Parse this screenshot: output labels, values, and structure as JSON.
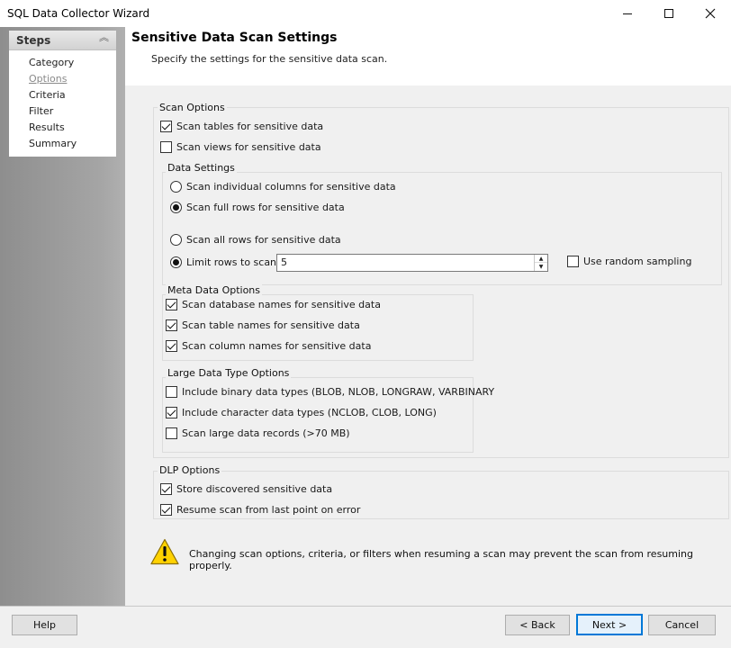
{
  "window": {
    "title": "SQL Data Collector Wizard"
  },
  "steps": {
    "header": "Steps",
    "items": [
      {
        "label": "Category"
      },
      {
        "label": "Options"
      },
      {
        "label": "Criteria"
      },
      {
        "label": "Filter"
      },
      {
        "label": "Results"
      },
      {
        "label": "Summary"
      }
    ],
    "active": "Options"
  },
  "page": {
    "title": "Sensitive Data Scan Settings",
    "subtitle": "Specify the settings for the sensitive data scan."
  },
  "scan_options": {
    "label": "Scan Options",
    "scan_tables": {
      "label": "Scan tables for sensitive data",
      "checked": true
    },
    "scan_views": {
      "label": "Scan views for sensitive data",
      "checked": false
    }
  },
  "data_settings": {
    "label": "Data Settings",
    "scan_columns": {
      "label": "Scan individual columns for sensitive data",
      "selected": false
    },
    "scan_full_rows": {
      "label": "Scan full rows for sensitive data",
      "selected": true
    },
    "scan_all_rows": {
      "label": "Scan all rows for sensitive data",
      "selected": false
    },
    "limit_rows": {
      "label": "Limit rows to scan",
      "selected": true,
      "value": "5"
    },
    "random_sampling": {
      "label": "Use random sampling",
      "checked": false
    }
  },
  "meta_data_options": {
    "label": "Meta Data Options",
    "db_names": {
      "label": "Scan database names for sensitive data",
      "checked": true
    },
    "table_names": {
      "label": "Scan table names for sensitive data",
      "checked": true
    },
    "column_names": {
      "label": "Scan column names for sensitive data",
      "checked": true
    }
  },
  "large_data_options": {
    "label": "Large Data Type Options",
    "binary": {
      "label": "Include binary data types (BLOB, NLOB, LONGRAW, VARBINARY",
      "checked": false
    },
    "character": {
      "label": "Include character data types (NCLOB, CLOB, LONG)",
      "checked": true
    },
    "large_records": {
      "label": "Scan large data records (>70 MB)",
      "checked": false
    }
  },
  "dlp_options": {
    "label": "DLP Options",
    "store_discovered": {
      "label": "Store discovered sensitive data",
      "checked": true
    },
    "resume_scan": {
      "label": "Resume scan from last point on error",
      "checked": true
    }
  },
  "warning": {
    "icon": "warning-icon",
    "text": "Changing scan options, criteria, or filters when resuming a scan may prevent the scan from resuming properly."
  },
  "footer": {
    "help": "Help",
    "back": "< Back",
    "next": "Next >",
    "cancel": "Cancel"
  },
  "colors": {
    "accent": "#0078d7",
    "warning_yellow": "#ffd200"
  }
}
